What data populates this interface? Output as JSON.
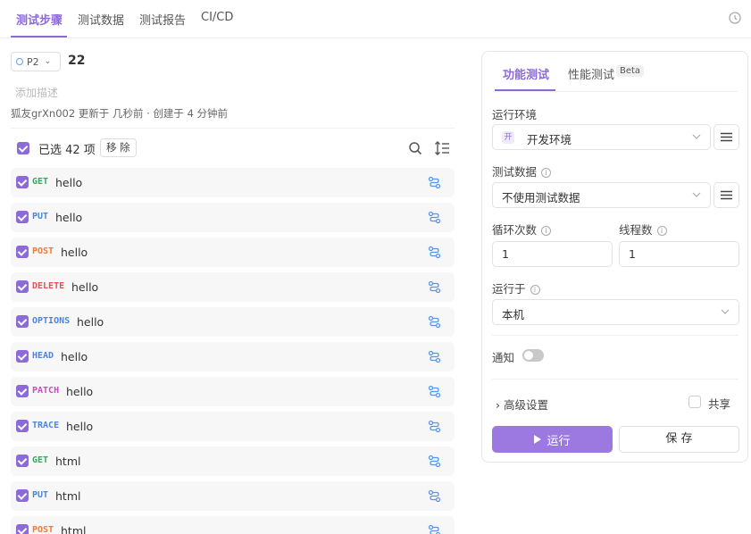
{
  "tabs": [
    {
      "label": "测试步骤"
    },
    {
      "label": "测试数据"
    },
    {
      "label": "测试报告"
    },
    {
      "label": "CI/CD"
    }
  ],
  "case": {
    "priority": "P2",
    "number": "22",
    "description_placeholder": "添加描述",
    "meta": "狐友grXn002 更新于 几秒前 · 创建于 4 分钟前"
  },
  "selection": {
    "text": "已选 42 项",
    "remove_label": "移 除"
  },
  "method_colors": {
    "GET": "#2faa5c",
    "PUT": "#4a86e0",
    "POST": "#f07a32",
    "DELETE": "#e84f4f",
    "OPTIONS": "#4a86e0",
    "HEAD": "#4a86e0",
    "PATCH": "#d048c4",
    "TRACE": "#4a86e0"
  },
  "steps": [
    {
      "method": "GET",
      "name": "hello"
    },
    {
      "method": "PUT",
      "name": "hello"
    },
    {
      "method": "POST",
      "name": "hello"
    },
    {
      "method": "DELETE",
      "name": "hello"
    },
    {
      "method": "OPTIONS",
      "name": "hello"
    },
    {
      "method": "HEAD",
      "name": "hello"
    },
    {
      "method": "PATCH",
      "name": "hello"
    },
    {
      "method": "TRACE",
      "name": "hello"
    },
    {
      "method": "GET",
      "name": "html"
    },
    {
      "method": "PUT",
      "name": "html"
    },
    {
      "method": "POST",
      "name": "html"
    }
  ],
  "panel": {
    "tab_functional": "功能测试",
    "tab_performance": "性能测试",
    "beta": "Beta",
    "env_label": "运行环境",
    "env_badge": "开",
    "env_value": "开发环境",
    "data_label": "测试数据",
    "data_value": "不使用测试数据",
    "loop_label": "循环次数",
    "loop_value": "1",
    "threads_label": "线程数",
    "threads_value": "1",
    "runon_label": "运行于",
    "runon_value": "本机",
    "notify_label": "通知",
    "notify_on": false,
    "advanced_label": "高级设置",
    "share_label": "共享",
    "run_label": "运行",
    "save_label": "保 存"
  },
  "accent": "#8c6ad8"
}
